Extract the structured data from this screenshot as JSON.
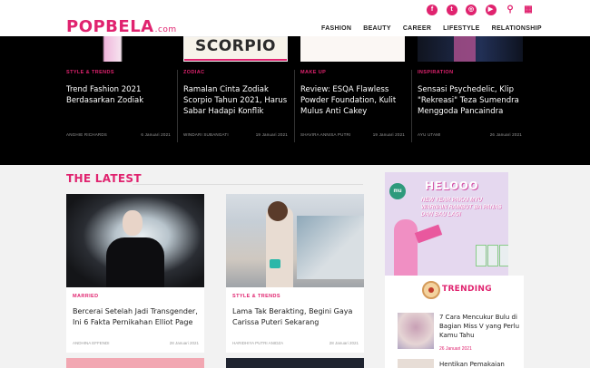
{
  "header": {
    "logo_main": "POPBELA",
    "logo_suffix": ".com",
    "socials": [
      {
        "icon": "facebook-icon",
        "glyph": "f"
      },
      {
        "icon": "twitter-icon",
        "glyph": "t"
      },
      {
        "icon": "instagram-icon",
        "glyph": "◎"
      },
      {
        "icon": "youtube-icon",
        "glyph": "▶"
      }
    ],
    "search_glyph": "⚲",
    "menu_glyph": "▦",
    "nav": [
      "FASHION",
      "BEAUTY",
      "CAREER",
      "LIFESTYLE",
      "RELATIONSHIP"
    ]
  },
  "featured": {
    "thumb_word": "SCORPIO",
    "items": [
      {
        "category": "STYLE & TRENDS",
        "title": "Trend Fashion 2021 Berdasarkan Zodiak",
        "author": "ANGHIE RICHARDS",
        "date": "6 Januari 2021"
      },
      {
        "category": "ZODIAC",
        "title": "Ramalan Cinta Zodiak Scorpio Tahun 2021, Harus Sabar Hadapi Konflik",
        "author": "WINDARI SUBANGATI",
        "date": "19 Januari 2021"
      },
      {
        "category": "MAKE UP",
        "title": "Review: ESQA Flawless Powder Foundation, Kulit Mulus Anti Cakey",
        "author": "SHAVIRA ANNISA PUTRI",
        "date": "19 Januari 2021"
      },
      {
        "category": "INSPIRATION",
        "title": "Sensasi Psychedelic, Klip \"Rekreasi\" Teza Sumendra Menggoda Pancaindra",
        "author": "AYU UTAMI",
        "date": "26 Januari 2021"
      }
    ]
  },
  "latest": {
    "heading": "THE LATEST",
    "items": [
      {
        "category": "MARRIED",
        "title": "Bercerai Setelah Jadi Transgender, Ini 6 Fakta Pernikahan Elliot Page",
        "author": "ANDHINA EFFENDI",
        "date": "28 Januari 2021"
      },
      {
        "category": "STYLE & TRENDS",
        "title": "Lama Tak Berakting, Begini Gaya Carissa  Puteri Sekarang",
        "author": "HARIDHIYA PUTRI ANIDZA",
        "date": "28 Januari 2021"
      }
    ]
  },
  "ad": {
    "logo": "mu",
    "headline": "HELOOO",
    "subline": "NEW YEAR PAKAI MYU WARNAIN RAMBUT BA PANAS DAN BAU LAGI"
  },
  "trending": {
    "heading": "TRENDING",
    "items": [
      {
        "title": "7 Cara Mencukur Bulu di Bagian Miss V yang Perlu Kamu Tahu",
        "date": "26 Januari 2021"
      },
      {
        "title": "Hentikan Pemakaian",
        "date": ""
      }
    ]
  },
  "colors": {
    "accent": "#e0236f",
    "band": "#000000"
  }
}
